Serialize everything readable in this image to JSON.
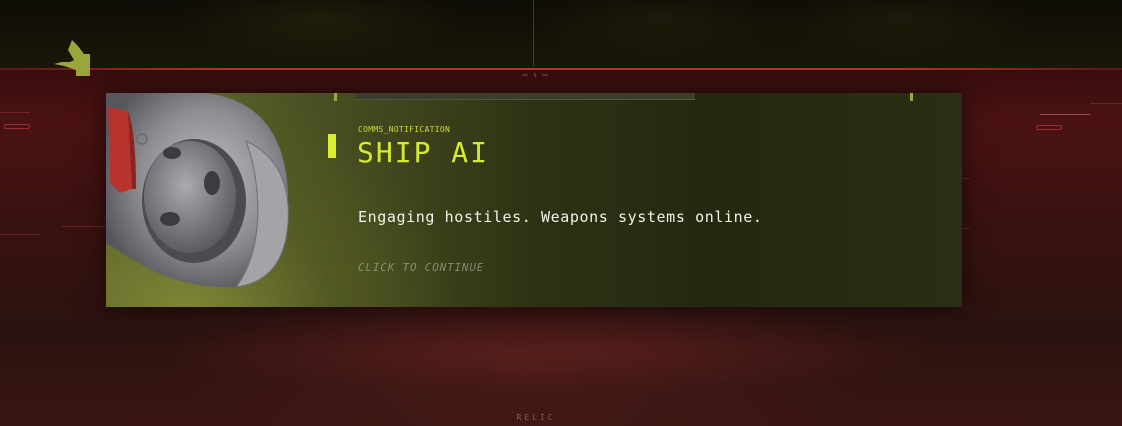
{
  "notification": {
    "channel": "COMMS_NOTIFICATION",
    "speaker": "SHIP AI",
    "message": "Engaging hostiles. Weapons systems online.",
    "prompt": "CLICK TO CONTINUE",
    "portrait_icon": "ship-ai-drone-icon"
  },
  "footer": {
    "brand": "RELIC"
  },
  "colors": {
    "accent": "#d8ee2e",
    "card_bg": "#2f3314",
    "hud_red": "#b8322a",
    "message_text": "#f2f2ea"
  }
}
